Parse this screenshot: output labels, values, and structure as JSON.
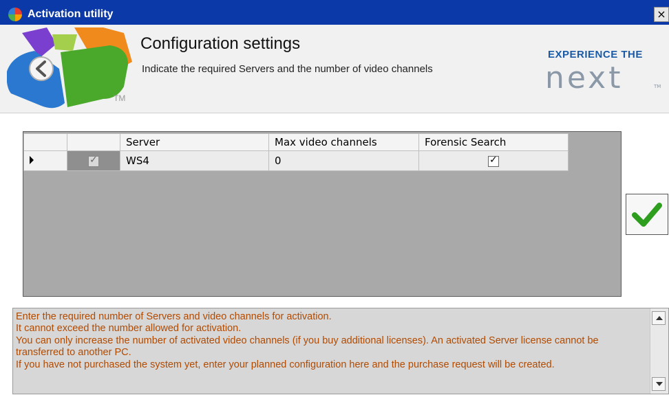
{
  "window": {
    "title": "Activation utility",
    "close_glyph": "×",
    "icon": "activation-utility-icon"
  },
  "header": {
    "title": "Configuration settings",
    "subtitle": "Indicate the required Servers and the number of video channels",
    "logo_tm": "TM",
    "back_icon": "back-arrow-icon",
    "brand": {
      "tagline": "EXPERIENCE THE",
      "word": "next",
      "tm": "TM"
    }
  },
  "grid": {
    "columns": [
      "",
      "",
      "Server",
      "Max video channels",
      "Forensic Search"
    ],
    "rows": [
      {
        "selected": true,
        "checked": true,
        "server": "WS4",
        "max_video_channels": "0",
        "forensic_search": true
      }
    ]
  },
  "apply_button": {
    "icon": "checkmark-icon",
    "color": "#2e9e1f"
  },
  "info": {
    "lines": [
      "Enter the required number of Servers and video channels for activation.",
      "It cannot exceed the number allowed for activation.",
      "You can only increase the number of activated video channels (if you buy additional licenses). An activated Server license cannot be transferred to another PC.",
      "If you have not purchased the system yet, enter your planned configuration here and the purchase request  will be created."
    ],
    "text_color": "#b24a00"
  },
  "colors": {
    "titlebar": "#0b3aa8",
    "brand_blue": "#1a5aa6",
    "grid_bg": "#a9a9a9"
  }
}
